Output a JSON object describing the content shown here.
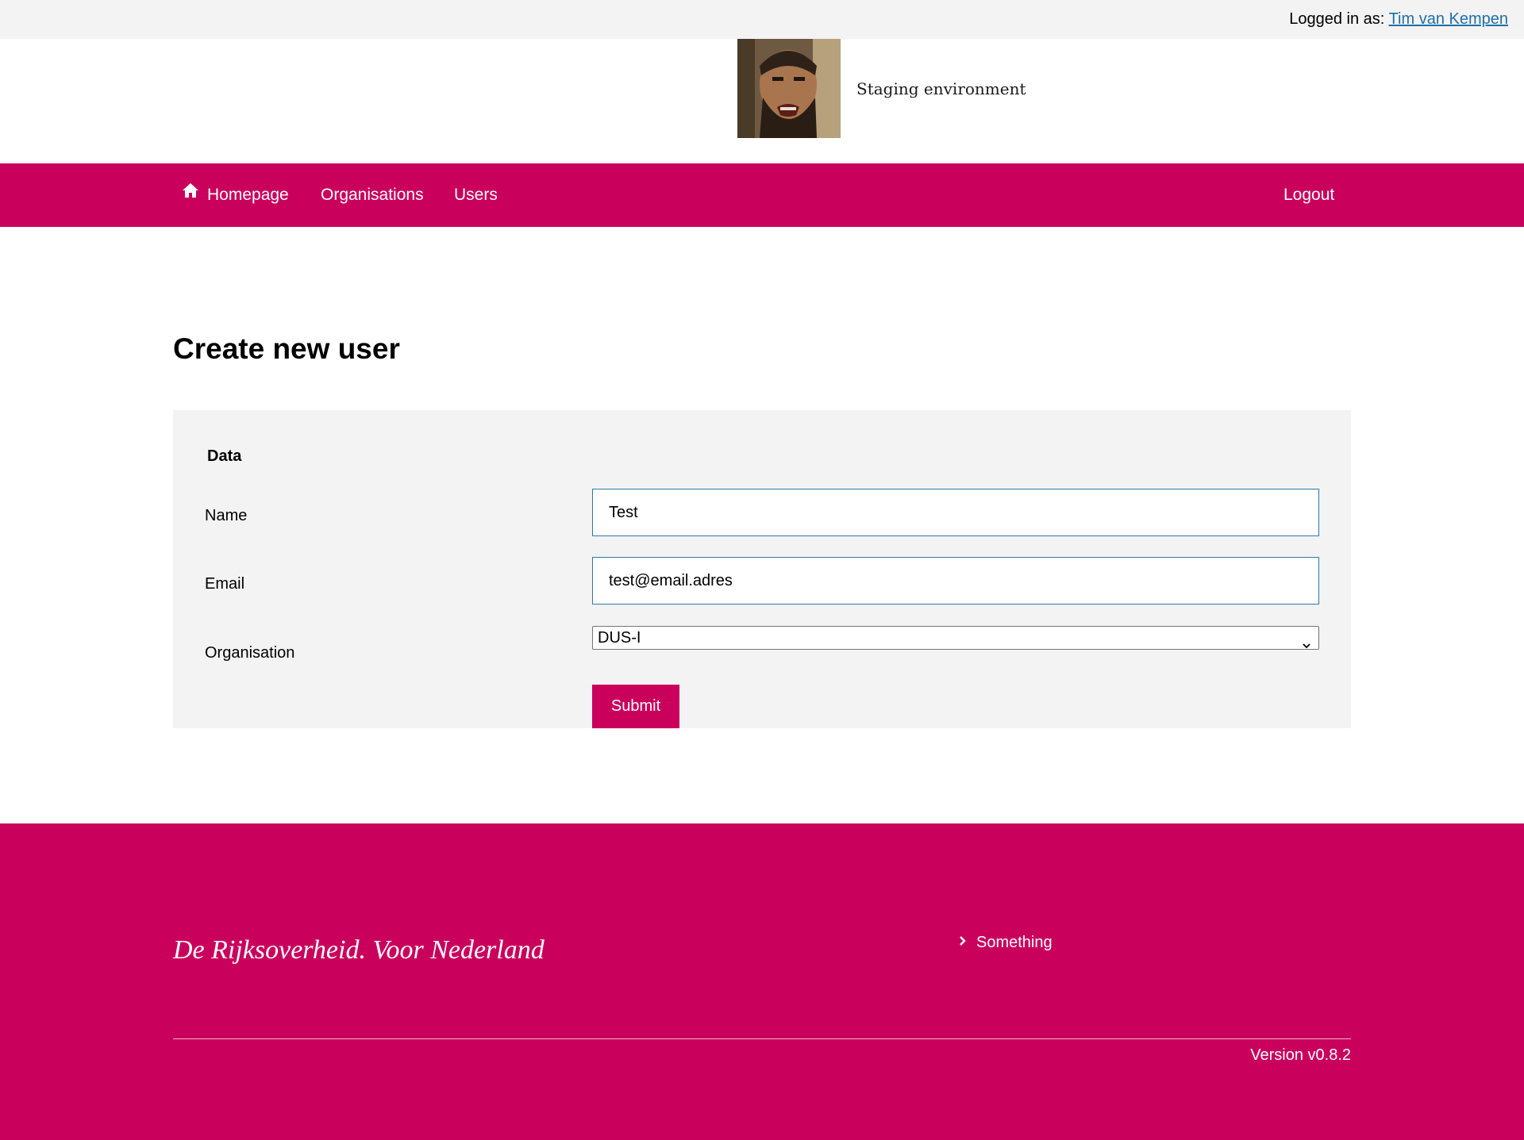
{
  "topbar": {
    "logged_in_label": "Logged in as:",
    "user_name": "Tim van Kempen"
  },
  "header": {
    "logo_alt": "Spartan portrait logo",
    "environment": "Staging environment"
  },
  "nav": {
    "items": [
      {
        "label": "Homepage",
        "icon": "home-icon"
      },
      {
        "label": "Organisations"
      },
      {
        "label": "Users"
      }
    ],
    "logout_label": "Logout"
  },
  "page": {
    "title": "Create new user"
  },
  "form": {
    "section_title": "Data",
    "name_label": "Name",
    "name_value": "Test",
    "email_label": "Email",
    "email_value": "test@email.adres",
    "organisation_label": "Organisation",
    "organisation_selected": "DUS-I",
    "submit_label": "Submit"
  },
  "footer": {
    "tagline": "De Rijksoverheid. Voor Nederland",
    "links": [
      {
        "label": "Something",
        "icon": "chevron-right-icon"
      }
    ],
    "version": "Version v0.8.2"
  },
  "colors": {
    "brand": "#ca005d",
    "panel_bg": "#f3f3f3",
    "link": "#1f6fa8",
    "input_border": "#2a7aa8"
  }
}
